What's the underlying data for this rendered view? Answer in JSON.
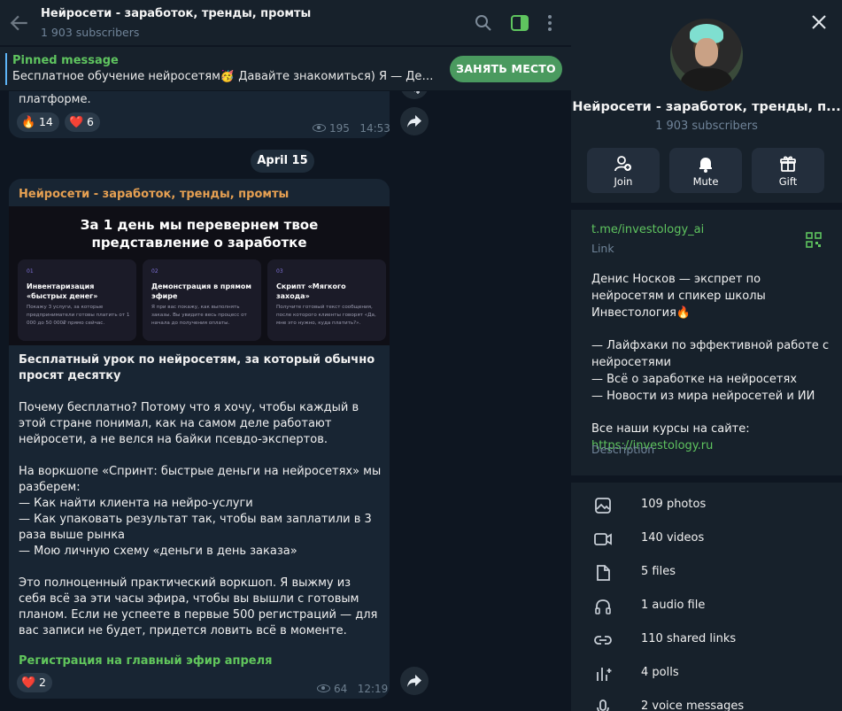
{
  "header": {
    "title": "Нейросети - заработок, тренды, промты",
    "subscribers": "1 903 subscribers"
  },
  "pinned": {
    "label": "Pinned message",
    "text": "Бесплатное обучение нейросетям🥳  Давайте знакомиться) Я — Денис Носков — экспрет по нейросетям",
    "button": "ЗАНЯТЬ МЕСТО"
  },
  "message1": {
    "text_tail": "платформе.",
    "reactions": [
      {
        "emoji": "🔥",
        "count": "14"
      },
      {
        "emoji": "❤️",
        "count": "6"
      }
    ],
    "views": "195",
    "time": "14:53"
  },
  "date_separator": "April 15",
  "message2": {
    "author": "Нейросети - заработок, тренды, промты",
    "banner": {
      "title_line1": "За 1 день мы перевернем твое",
      "title_line2": "представление о заработке",
      "cards": [
        {
          "num": "01",
          "title": "Инвентаризация «быстрых денег»",
          "desc": "Покажу 3 услуги, за которые предприниматели готовы платить от 1 000 до 50 000₽ прямо сейчас."
        },
        {
          "num": "02",
          "title": "Демонстрация в прямом эфире",
          "desc": "Я при вас покажу, как выполнять заказы. Вы увидите весь процесс от начала до получения оплаты."
        },
        {
          "num": "03",
          "title": "Скрипт «Мягкого захода»",
          "desc": "Получите готовый текст сообщения, после которого клиенты говорят «Да, мне это нужно, куда платить?»."
        }
      ]
    },
    "heading": "Бесплатный урок по нейросетям, за который обычно просят десятку",
    "para1": "Почему бесплатно? Потому что я хочу, чтобы каждый в этой стране понимал, как на самом деле работают нейросети, а не велся на байки псевдо-экспертов.",
    "para2_intro": "На воркшопе «Спринт: быстрые деньги на нейросетях» мы разберем:",
    "bullets": [
      "— Как найти клиента на нейро-услуги",
      "— Как упаковать результат так, чтобы вам заплатили в 3 раза выше рынка",
      "— Мою личную схему «деньги в день заказа»"
    ],
    "para3": "Это полноценный практический воркшоп. Я выжму из себя всё за эти часы эфира, чтобы вы вышли с готовым планом. Если не успеете в первые 500 регистраций — для вас записи не будет, придется ловить всё в моменте.",
    "link": "Регистрация на главный эфир апреля",
    "reactions": [
      {
        "emoji": "❤️",
        "count": "2"
      }
    ],
    "views": "64",
    "time": "12:19"
  },
  "panel": {
    "title": "Нейросети - заработок, тренды, п...",
    "subscribers": "1 903 subscribers",
    "actions": [
      {
        "label": "Join",
        "icon": "add-user-icon"
      },
      {
        "label": "Mute",
        "icon": "bell-icon"
      },
      {
        "label": "Gift",
        "icon": "gift-icon"
      }
    ],
    "link": "t.me/investology_ai",
    "link_label": "Link",
    "desc_line1": "Денис Носков — экспрет по нейросетям и спикер школы Инвестология🔥",
    "desc_bullets": [
      "— Лайфхаки по эффективной работе с нейросетями",
      "— Всё о заработке на нейросетях",
      "— Новости из мира нейросетей и ИИ"
    ],
    "desc_courses": "Все наши курсы на сайте:",
    "desc_site": "https://investology.ru",
    "desc_label": "Description",
    "media": [
      {
        "label": "109 photos",
        "icon": "photo-icon"
      },
      {
        "label": "140 videos",
        "icon": "video-icon"
      },
      {
        "label": "5 files",
        "icon": "file-icon"
      },
      {
        "label": "1 audio file",
        "icon": "headphones-icon"
      },
      {
        "label": "110 shared links",
        "icon": "link-icon"
      },
      {
        "label": "4 polls",
        "icon": "poll-icon"
      },
      {
        "label": "2 voice messages",
        "icon": "mic-icon"
      }
    ]
  },
  "colors": {
    "accent_green": "#5fc45f",
    "author_orange": "#e6a052",
    "bubble_bg": "#182533",
    "panel_bg": "#17212b",
    "chat_bg": "#0e1621"
  }
}
